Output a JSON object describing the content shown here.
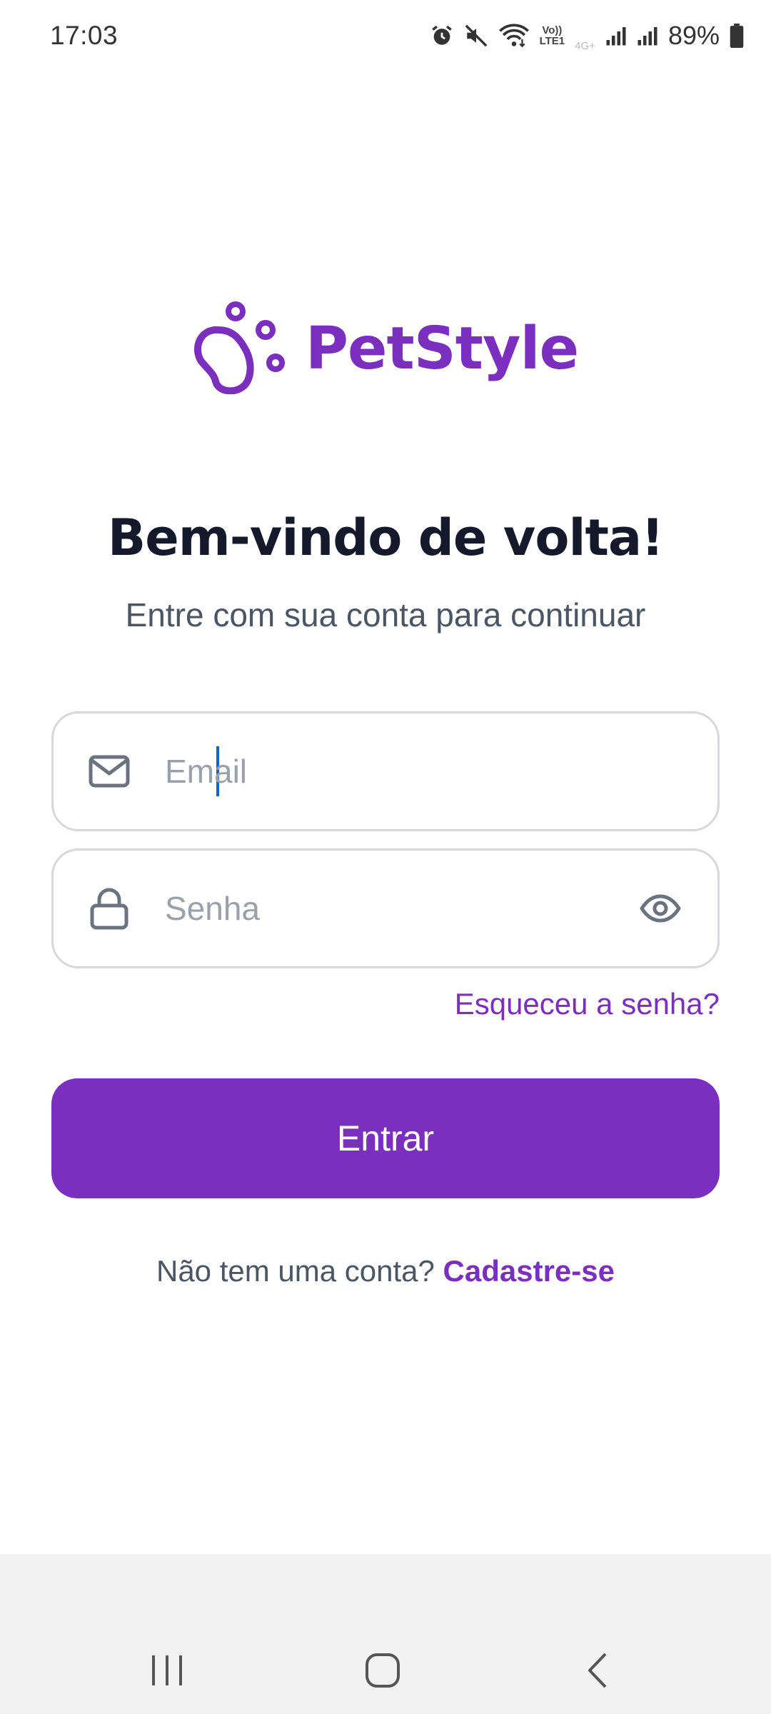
{
  "status_bar": {
    "time": "17:03",
    "volte_top": "Vo))",
    "volte_bottom": "LTE1",
    "network_type": "4G+",
    "battery_percent": "89%"
  },
  "logo": {
    "text": "PetStyle",
    "icon": "paw-icon",
    "color": "#7b2fbe"
  },
  "header": {
    "title": "Bem-vindo de volta!",
    "subtitle": "Entre com sua conta para continuar"
  },
  "form": {
    "email": {
      "placeholder": "Email",
      "value": "",
      "icon": "mail-icon"
    },
    "password": {
      "placeholder": "Senha",
      "value": "",
      "icon": "lock-icon",
      "toggle_icon": "eye-icon"
    },
    "forgot_label": "Esqueceu a senha?",
    "submit_label": "Entrar"
  },
  "signup": {
    "prompt": "Não tem uma conta?",
    "link_label": "Cadastre-se"
  },
  "colors": {
    "accent": "#7b2fbe",
    "title": "#141a2c",
    "muted": "#4b5563",
    "border": "#d7d7dc"
  },
  "nav_bar": {
    "recents_icon": "recents-icon",
    "home_icon": "home-icon",
    "back_icon": "back-icon"
  }
}
